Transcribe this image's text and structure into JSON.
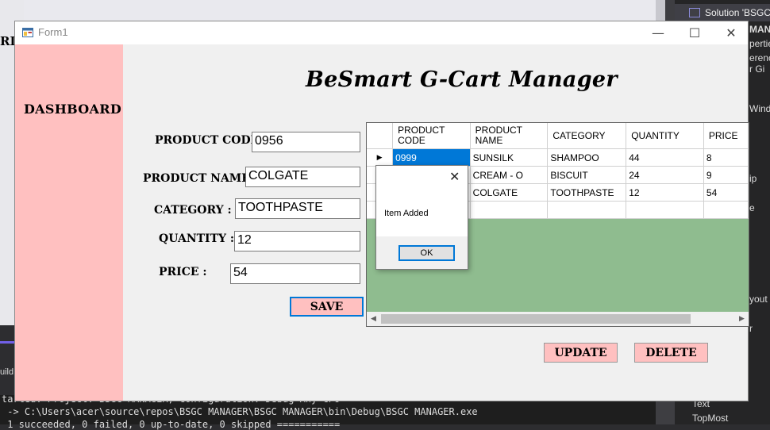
{
  "ide": {
    "left_fragment": "RI",
    "build_label": "uild",
    "solution_label": "Solution 'BSGC",
    "right_fragments": [
      "MANA",
      "pertie",
      "erence",
      "r  Gi",
      "Wind",
      "ip",
      "e",
      "yout",
      "r"
    ],
    "properties": [
      "Text",
      "TopMost"
    ],
    "output_lines": [
      "tarted: Project: BSGC MANAGER, Configuration: Debug Any CPU",
      " -> C:\\Users\\acer\\source\\repos\\BSGC MANAGER\\BSGC MANAGER\\bin\\Debug\\BSGC MANAGER.exe",
      " 1 succeeded, 0 failed, 0 up-to-date, 0 skipped ==========="
    ]
  },
  "window": {
    "title": "Form1",
    "minimize_glyph": "—",
    "maximize_glyph": "☐",
    "close_glyph": "✕"
  },
  "sidebar": {
    "dashboard_label": "DASHBOARD"
  },
  "app_title": "BeSmart G-Cart Manager",
  "form": {
    "product_code_label": "PRODUCT CODE :",
    "product_code_value": "0956",
    "product_name_label": "PRODUCT NAME :",
    "product_name_value": "COLGATE",
    "category_label": "CATEGORY :",
    "category_value": "TOOTHPASTE",
    "quantity_label": "QUANTITY :",
    "quantity_value": "12",
    "price_label": "PRICE :",
    "price_value": "54",
    "save_label": "SAVE",
    "update_label": "UPDATE",
    "delete_label": "DELETE"
  },
  "grid": {
    "headers": [
      [
        "PRODUCT",
        "CODE"
      ],
      [
        "PRODUCT",
        "NAME"
      ],
      [
        "CATEGORY",
        ""
      ],
      [
        "QUANTITY",
        ""
      ],
      [
        "PRICE",
        ""
      ]
    ],
    "rows": [
      [
        "0999",
        "SUNSILK",
        "SHAMPOO",
        "44",
        "8"
      ],
      [
        "",
        "CREAM - O",
        "BISCUIT",
        "24",
        "9"
      ],
      [
        "",
        "COLGATE",
        "TOOTHPASTE",
        "12",
        "54"
      ],
      [
        "",
        "",
        "",
        "",
        ""
      ]
    ],
    "current_row_glyph": "▶",
    "new_row_glyph": "*",
    "scroll_left": "◀",
    "scroll_right": "▶"
  },
  "message_box": {
    "text": "Item Added",
    "ok_label": "OK",
    "close_glyph": "✕"
  },
  "colors": {
    "sidebar": "#ffc0c0",
    "grid_background": "#8fbc8f",
    "selection": "#0078d7"
  }
}
